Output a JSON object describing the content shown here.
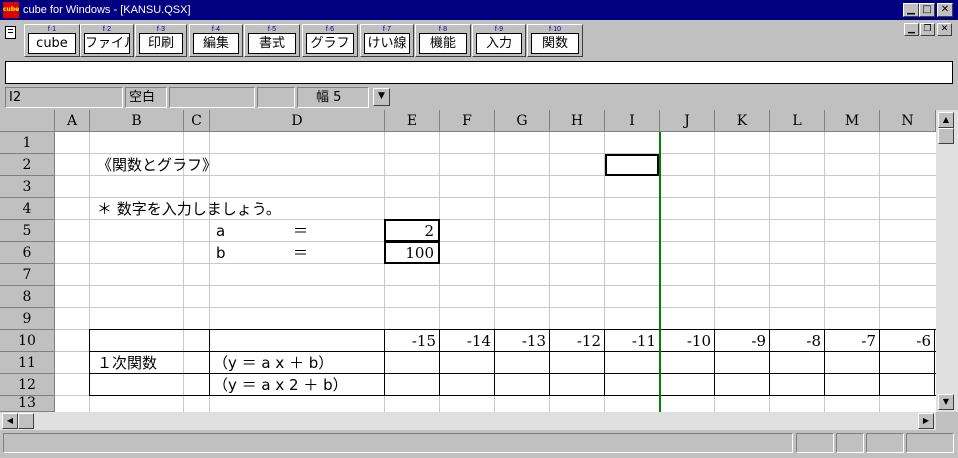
{
  "window": {
    "title": "cube for Windows - [KANSU.QSX]",
    "icon_label": "cube"
  },
  "caption_buttons": {
    "minimize": "▁",
    "maximize": "□",
    "close": "✕"
  },
  "mdi_buttons": {
    "minimize": "▁",
    "restore": "❐",
    "close": "✕"
  },
  "toolbar": [
    {
      "key": "f·1",
      "label": "cube"
    },
    {
      "key": "f·2",
      "label": "ファイル"
    },
    {
      "key": "f·3",
      "label": "印刷"
    },
    {
      "key": "f·4",
      "label": "編集"
    },
    {
      "key": "f·5",
      "label": "書式"
    },
    {
      "key": "f·6",
      "label": "グラフ"
    },
    {
      "key": "f·7",
      "label": "けい線"
    },
    {
      "key": "f·8",
      "label": "機能"
    },
    {
      "key": "f·9",
      "label": "入力"
    },
    {
      "key": "f·10",
      "label": "関数"
    }
  ],
  "input_bar": {
    "value": ""
  },
  "status_row": {
    "cell_ref": "I2",
    "state": "空白",
    "width_label": "幅 5",
    "dropdown_icon": "▼"
  },
  "columns": [
    "A",
    "B",
    "C",
    "D",
    "E",
    "F",
    "G",
    "H",
    "I",
    "J",
    "K",
    "L",
    "M",
    "N"
  ],
  "rows": [
    "1",
    "2",
    "3",
    "4",
    "5",
    "6",
    "7",
    "8",
    "9",
    "10",
    "11",
    "12",
    "13"
  ],
  "cells": {
    "b2": "《関数とグラフ》",
    "b4": "＊ 数字を入力しましょう。",
    "d5_label": "a",
    "d5_eq": "＝",
    "e5": "2",
    "d6_label": "b",
    "d6_eq": "＝",
    "e6": "100",
    "row10_values": [
      "-15",
      "-14",
      "-13",
      "-12",
      "-11",
      "-10",
      "-9",
      "-8",
      "-7",
      "-6"
    ],
    "b11": "１次関数",
    "d11": "（y ＝ a x ＋ b）",
    "d12": "（y ＝ a x 2 ＋ b）"
  },
  "scroll": {
    "up": "▲",
    "down": "▼",
    "left": "◀",
    "right": "▶"
  }
}
